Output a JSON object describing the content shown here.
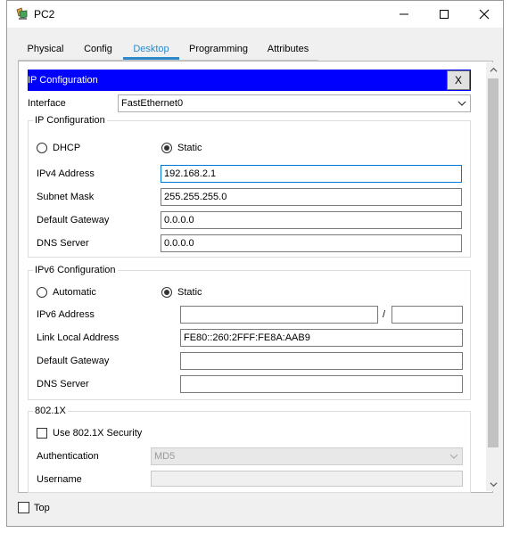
{
  "window": {
    "title": "PC2",
    "minimize_icon": "minimize-icon",
    "maximize_icon": "maximize-icon",
    "close_icon": "close-icon"
  },
  "tabs": [
    {
      "label": "Physical",
      "active": false
    },
    {
      "label": "Config",
      "active": false
    },
    {
      "label": "Desktop",
      "active": true
    },
    {
      "label": "Programming",
      "active": false
    },
    {
      "label": "Attributes",
      "active": false
    }
  ],
  "ip_config": {
    "header": "IP Configuration",
    "close_label": "X",
    "interface_label": "Interface",
    "interface_value": "FastEthernet0",
    "ipv4": {
      "group_title": "IP Configuration",
      "dhcp_label": "DHCP",
      "static_label": "Static",
      "selected": "Static",
      "address_label": "IPv4 Address",
      "address_value": "192.168.2.1",
      "mask_label": "Subnet Mask",
      "mask_value": "255.255.255.0",
      "gateway_label": "Default Gateway",
      "gateway_value": "0.0.0.0",
      "dns_label": "DNS Server",
      "dns_value": "0.0.0.0"
    },
    "ipv6": {
      "group_title": "IPv6 Configuration",
      "automatic_label": "Automatic",
      "static_label": "Static",
      "selected": "Static",
      "address_label": "IPv6 Address",
      "address_value": "",
      "slash": "/",
      "prefix_value": "",
      "link_local_label": "Link Local Address",
      "link_local_value": "FE80::260:2FFF:FE8A:AAB9",
      "gateway_label": "Default Gateway",
      "gateway_value": "",
      "dns_label": "DNS Server",
      "dns_value": ""
    },
    "dot1x": {
      "group_title": "802.1X",
      "use_label": "Use 802.1X Security",
      "use_checked": false,
      "auth_label": "Authentication",
      "auth_value": "MD5",
      "username_label": "Username",
      "username_value": ""
    }
  },
  "footer": {
    "top_label": "Top",
    "top_checked": false
  },
  "colors": {
    "accent": "#2e89c8",
    "header_bg": "#0000ff",
    "window_bg": "#f0f0f0"
  }
}
